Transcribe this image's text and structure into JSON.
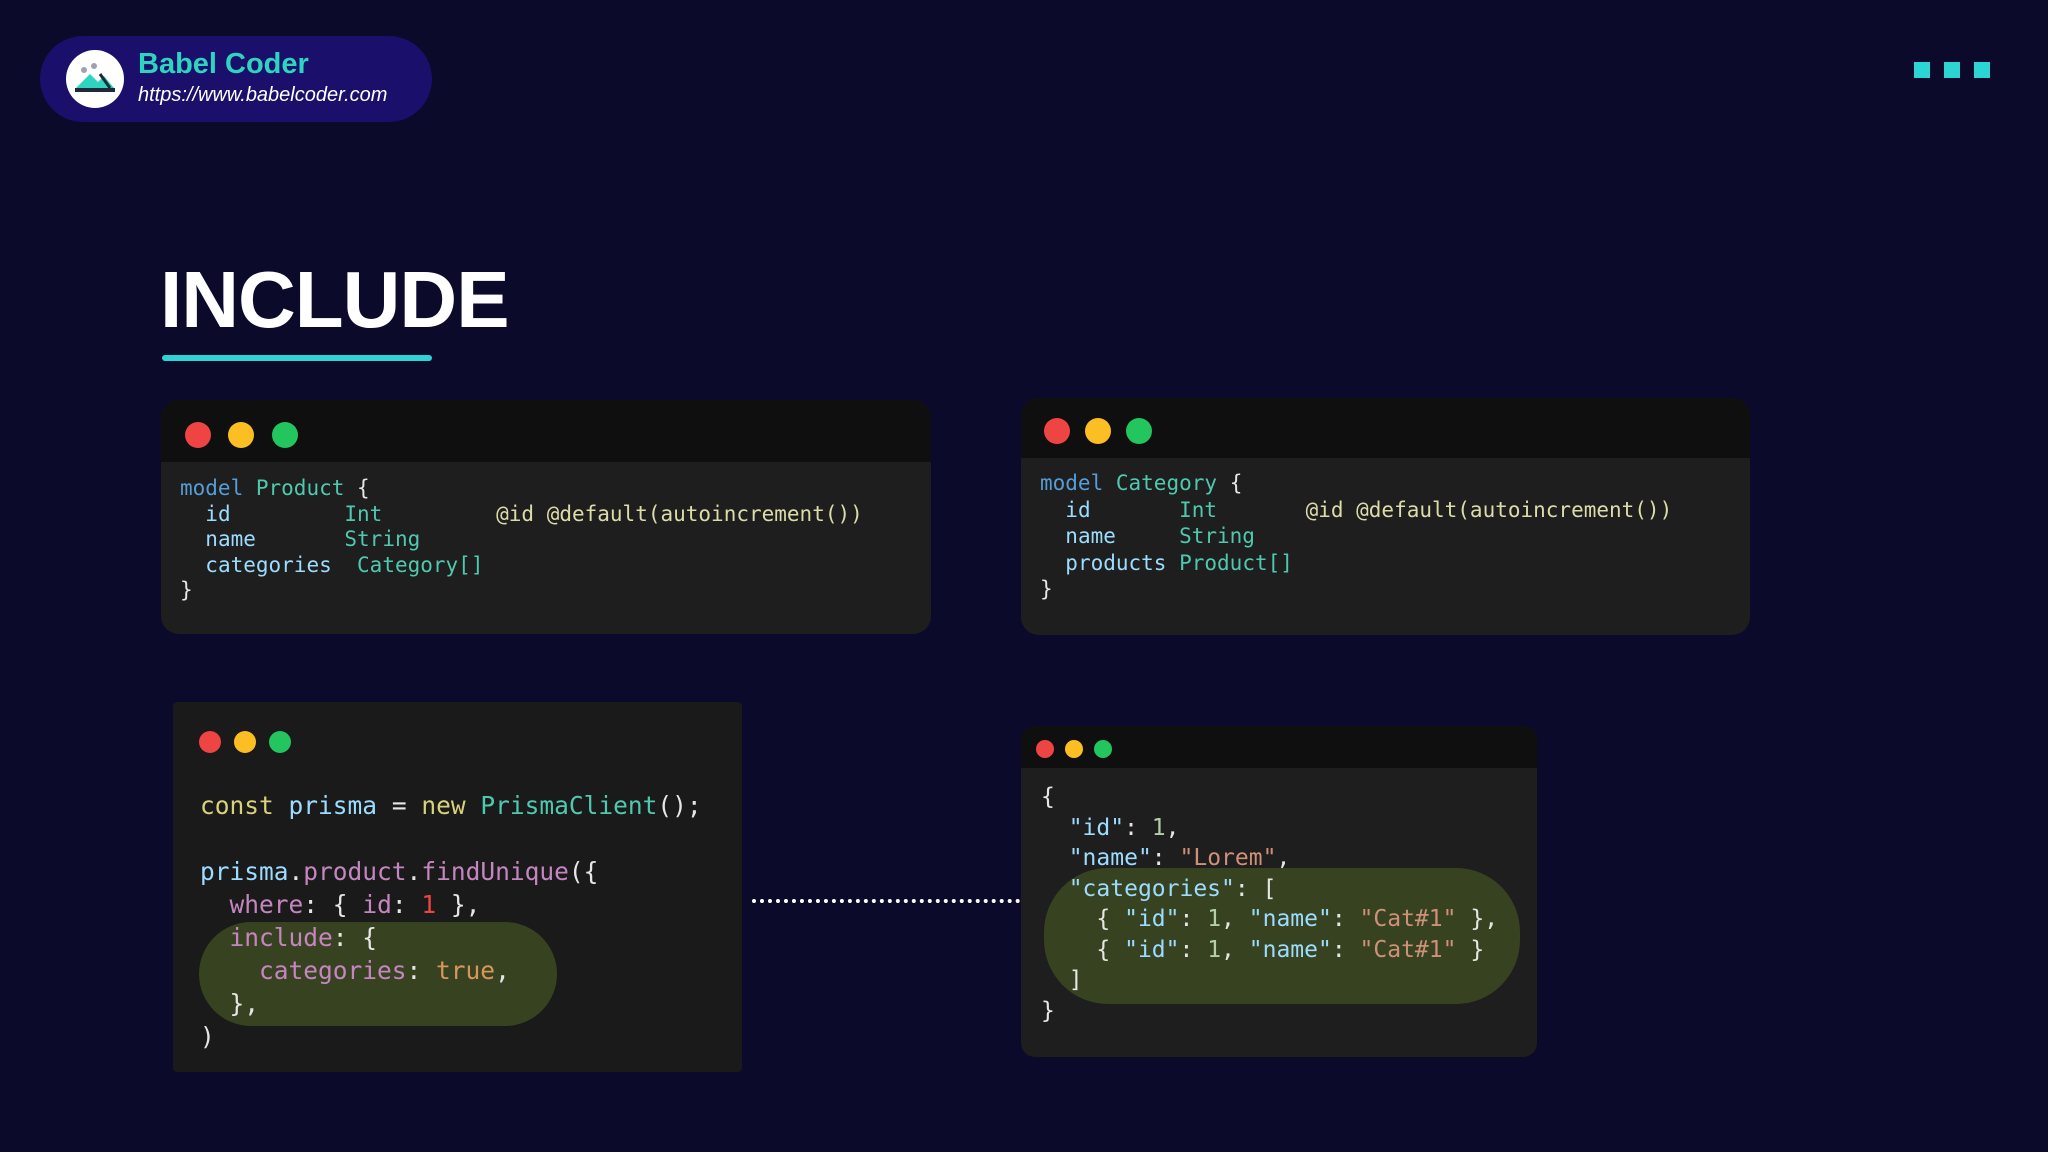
{
  "brand": {
    "name": "Babel Coder",
    "url": "https://www.babelcoder.com",
    "logo_icon": "babel-coder-logo-icon"
  },
  "menu_icon": "three-squares-icon",
  "title": "INCLUDE",
  "colors": {
    "background": "#0c0a2a",
    "accent": "#2dd4d4",
    "brand_pill": "#1a0f6b",
    "highlight": "#3a4721"
  },
  "product_model": {
    "line1_kw": "model",
    "line1_name": "Product",
    "line1_open": "{",
    "fields": [
      {
        "name": "id",
        "type": "Int",
        "attrs": "@id @default(autoincrement())"
      },
      {
        "name": "name",
        "type": "String",
        "attrs": ""
      },
      {
        "name": "categories",
        "type": "Category[]",
        "attrs": ""
      }
    ],
    "close": "}"
  },
  "category_model": {
    "line1_kw": "model",
    "line1_name": "Category",
    "line1_open": "{",
    "fields": [
      {
        "name": "id",
        "type": "Int",
        "attrs": "@id @default(autoincrement())"
      },
      {
        "name": "name",
        "type": "String",
        "attrs": ""
      },
      {
        "name": "products",
        "type": "Product[]",
        "attrs": ""
      }
    ],
    "close": "}"
  },
  "query_code": {
    "const_kw": "const",
    "var": "prisma",
    "eq": "=",
    "new_kw": "new",
    "class": "PrismaClient",
    "ctor_end": "();",
    "obj": "prisma",
    "member": "product",
    "method": "findUnique",
    "call_open": "({",
    "where_key": "where",
    "where_open": "{",
    "id_key": "id",
    "id_val": "1",
    "where_close": "},",
    "include_key": "include",
    "include_open": "{",
    "categories_key": "categories",
    "categories_val": "true",
    "comma": ",",
    "include_close": "},",
    "call_close": ")"
  },
  "result_json": {
    "open": "{",
    "id_key": "\"id\"",
    "id_val": "1",
    "name_key": "\"name\"",
    "name_val": "\"Lorem\"",
    "categories_key": "\"categories\"",
    "arr_open": "[",
    "items": [
      {
        "id_key": "\"id\"",
        "id_val": "1",
        "name_key": "\"name\"",
        "name_val": "\"Cat#1\"",
        "end": "},"
      },
      {
        "id_key": "\"id\"",
        "id_val": "1",
        "name_key": "\"name\"",
        "name_val": "\"Cat#1\"",
        "end": "}"
      }
    ],
    "arr_close": "]",
    "close": "}"
  }
}
